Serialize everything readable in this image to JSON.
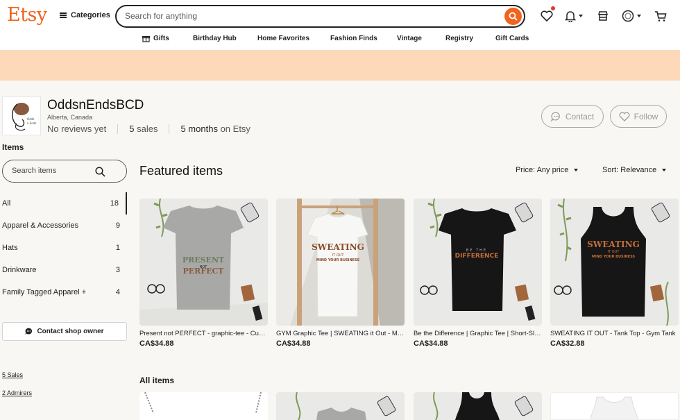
{
  "header": {
    "logo": "Etsy",
    "categories_label": "Categories",
    "search_placeholder": "Search for anything",
    "nav": [
      "Gifts",
      "Birthday Hub",
      "Home Favorites",
      "Fashion Finds",
      "Vintage",
      "Registry",
      "Gift Cards"
    ]
  },
  "shop": {
    "name": "OddsnEndsBCD",
    "location": "Alberta, Canada",
    "reviews": "No reviews yet",
    "sales_count": "5",
    "sales_label": "sales",
    "age_value": "5 months",
    "age_label": "on Etsy",
    "contact_label": "Contact",
    "follow_label": "Follow",
    "logo_text_1": "Odds",
    "logo_text_2": "n Ends"
  },
  "sidebar": {
    "title": "Items",
    "search_placeholder": "Search items",
    "items": [
      {
        "label": "All",
        "count": "18"
      },
      {
        "label": "Apparel & Accessories",
        "count": "9"
      },
      {
        "label": "Hats",
        "count": "1"
      },
      {
        "label": "Drinkware",
        "count": "3"
      },
      {
        "label": "Family Tagged Apparel +",
        "count": "4"
      }
    ],
    "contact_owner": "Contact shop owner",
    "sales_link": "5 Sales",
    "admirers_link": "2 Admirers"
  },
  "featured": {
    "title": "Featured items",
    "price_filter": "Price: Any price",
    "sort": "Sort: Relevance",
    "items": [
      {
        "title": "Present not PERFECT - graphic-tee - Custom Graphic Tee",
        "price": "CA$34.88",
        "print_1": "PRESENT",
        "print_2": "NOT",
        "print_3": "PERFECT"
      },
      {
        "title": "GYM Graphic Tee | SWEATING it Out - Mind Your Business",
        "price": "CA$34.88",
        "print_1": "SWEATING",
        "print_2": "IT OUT",
        "print_3": "MIND YOUR BUSINESS"
      },
      {
        "title": "Be the Difference | Graphic Tee | Short-Sleeve Unisex T-Shirt",
        "price": "CA$34.88",
        "print_1": "BE THE",
        "print_2": "DIFFERENCE"
      },
      {
        "title": "SWEATING IT OUT - Tank Top - Gym Tank",
        "price": "CA$32.88",
        "print_1": "SWEATING",
        "print_2": "IT OUT",
        "print_3": "MIND YOUR BUSINESS"
      }
    ]
  },
  "all_items": {
    "title": "All items"
  },
  "colors": {
    "brand": "#f1641e",
    "banner": "#fdd9b9",
    "page_bg": "#f8f7f4"
  }
}
